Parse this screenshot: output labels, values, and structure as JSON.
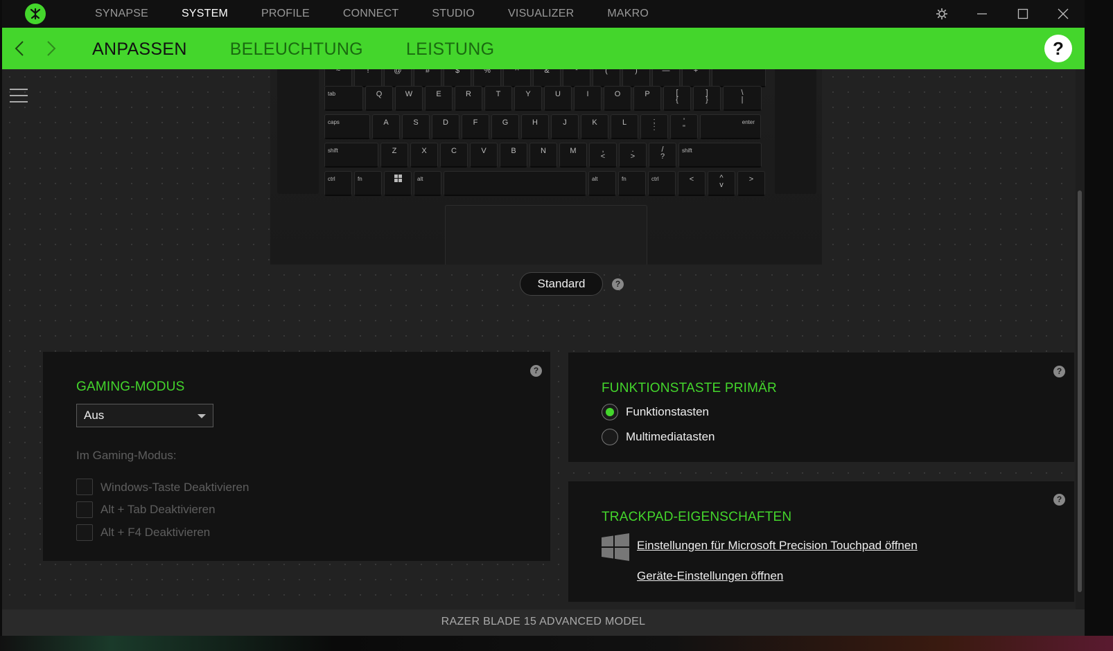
{
  "topnav": {
    "tabs": [
      {
        "label": "SYNAPSE",
        "active": false
      },
      {
        "label": "SYSTEM",
        "active": true
      },
      {
        "label": "PROFILE",
        "active": false
      },
      {
        "label": "CONNECT",
        "active": false
      },
      {
        "label": "STUDIO",
        "active": false
      },
      {
        "label": "VISUALIZER",
        "active": false
      },
      {
        "label": "MAKRO",
        "active": false
      }
    ]
  },
  "subnav": {
    "tabs": [
      {
        "label": "ANPASSEN",
        "active": true
      },
      {
        "label": "BELEUCHTUNG",
        "active": false
      },
      {
        "label": "LEISTUNG",
        "active": false
      }
    ],
    "help": "?"
  },
  "keyboard": {
    "rows": [
      [
        "~",
        "!",
        "@",
        "#",
        "$",
        "%",
        "^",
        "&",
        "*",
        "(",
        ")",
        "—",
        "+",
        ""
      ],
      [
        "tab",
        "Q",
        "W",
        "E",
        "R",
        "T",
        "Y",
        "U",
        "I",
        "O",
        "P",
        "[\n{",
        "]\n}",
        "\\\n|"
      ],
      [
        "caps",
        "A",
        "S",
        "D",
        "F",
        "G",
        "H",
        "J",
        "K",
        "L",
        ";\n:",
        "'\n\"",
        "enter"
      ],
      [
        "shift",
        "Z",
        "X",
        "C",
        "V",
        "B",
        "N",
        "M",
        ",\n<",
        ".\n>",
        "/\n?",
        "shift"
      ],
      [
        "ctrl",
        "fn",
        "",
        "alt",
        "",
        "alt",
        "fn",
        "ctrl",
        "<",
        "^\nv",
        ">"
      ]
    ]
  },
  "preset": {
    "label": "Standard",
    "help": "?"
  },
  "gaming_mode": {
    "title": "GAMING-MODUS",
    "select_value": "Aus",
    "sub_label": "Im Gaming-Modus:",
    "options": [
      {
        "label": "Windows-Taste Deaktivieren",
        "checked": false
      },
      {
        "label": "Alt + Tab Deaktivieren",
        "checked": false
      },
      {
        "label": "Alt + F4 Deaktivieren",
        "checked": false
      }
    ],
    "help": "?"
  },
  "function_key": {
    "title": "FUNKTIONSTASTE PRIMÄR",
    "options": [
      {
        "label": "Funktionstasten",
        "selected": true
      },
      {
        "label": "Multimediatasten",
        "selected": false
      }
    ],
    "help": "?"
  },
  "trackpad": {
    "title": "TRACKPAD-EIGENSCHAFTEN",
    "link1": "Einstellungen für Microsoft Precision Touchpad öffnen",
    "link2": "Geräte-Einstellungen öffnen",
    "help": "?"
  },
  "status": {
    "device_name": "RAZER BLADE 15 ADVANCED MODEL"
  },
  "colors": {
    "accent": "#44d62c",
    "background": "#202020",
    "panel": "#131313"
  }
}
